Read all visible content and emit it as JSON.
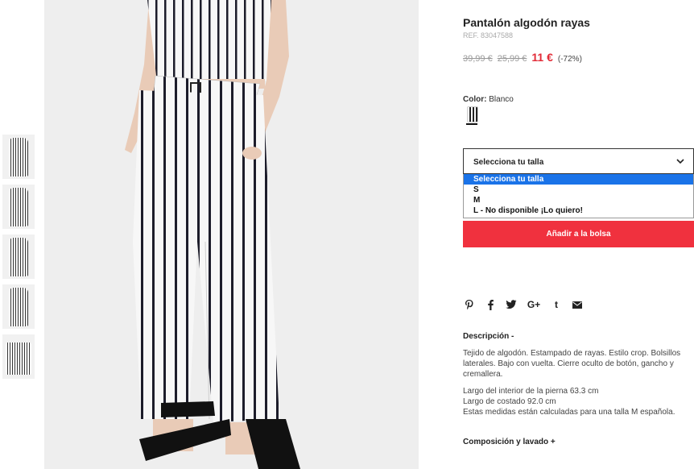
{
  "thumbnails": [
    "thumb-1",
    "thumb-2",
    "thumb-3",
    "thumb-4",
    "thumb-5"
  ],
  "product": {
    "title": "Pantalón algodón rayas",
    "ref": "REF. 83047588",
    "price_original": "39,99 €",
    "price_previous": "25,99 €",
    "price_current": "11 €",
    "discount": "(-72%)"
  },
  "color": {
    "label": "Color:",
    "value": "Blanco"
  },
  "size_select": {
    "label": "Selecciona tu talla",
    "options": [
      "Selecciona tu talla",
      "S",
      "M",
      "L - No disponible ¡Lo quiero!"
    ],
    "selected_index": 0
  },
  "add_button": "Añadir a la bolsa",
  "share_icons": [
    "pinterest-icon",
    "facebook-icon",
    "twitter-icon",
    "google-plus-icon",
    "tumblr-icon",
    "email-icon"
  ],
  "description": {
    "heading": "Descripción -",
    "paragraph1": "Tejido de algodón. Estampado de rayas. Estilo crop. Bolsillos laterales. Bajo con vuelta. Cierre oculto de botón, gancho y cremallera.",
    "line1": "Largo del interior de la pierna 63.3 cm",
    "line2": "Largo de costado 92.0 cm",
    "line3": "Estas medidas están calculadas para una talla M española."
  },
  "composition_heading": "Composición y lavado +",
  "colors": {
    "accent": "#f0313e",
    "sale_price": "#e22b37",
    "selected_option": "#1a73e8"
  }
}
